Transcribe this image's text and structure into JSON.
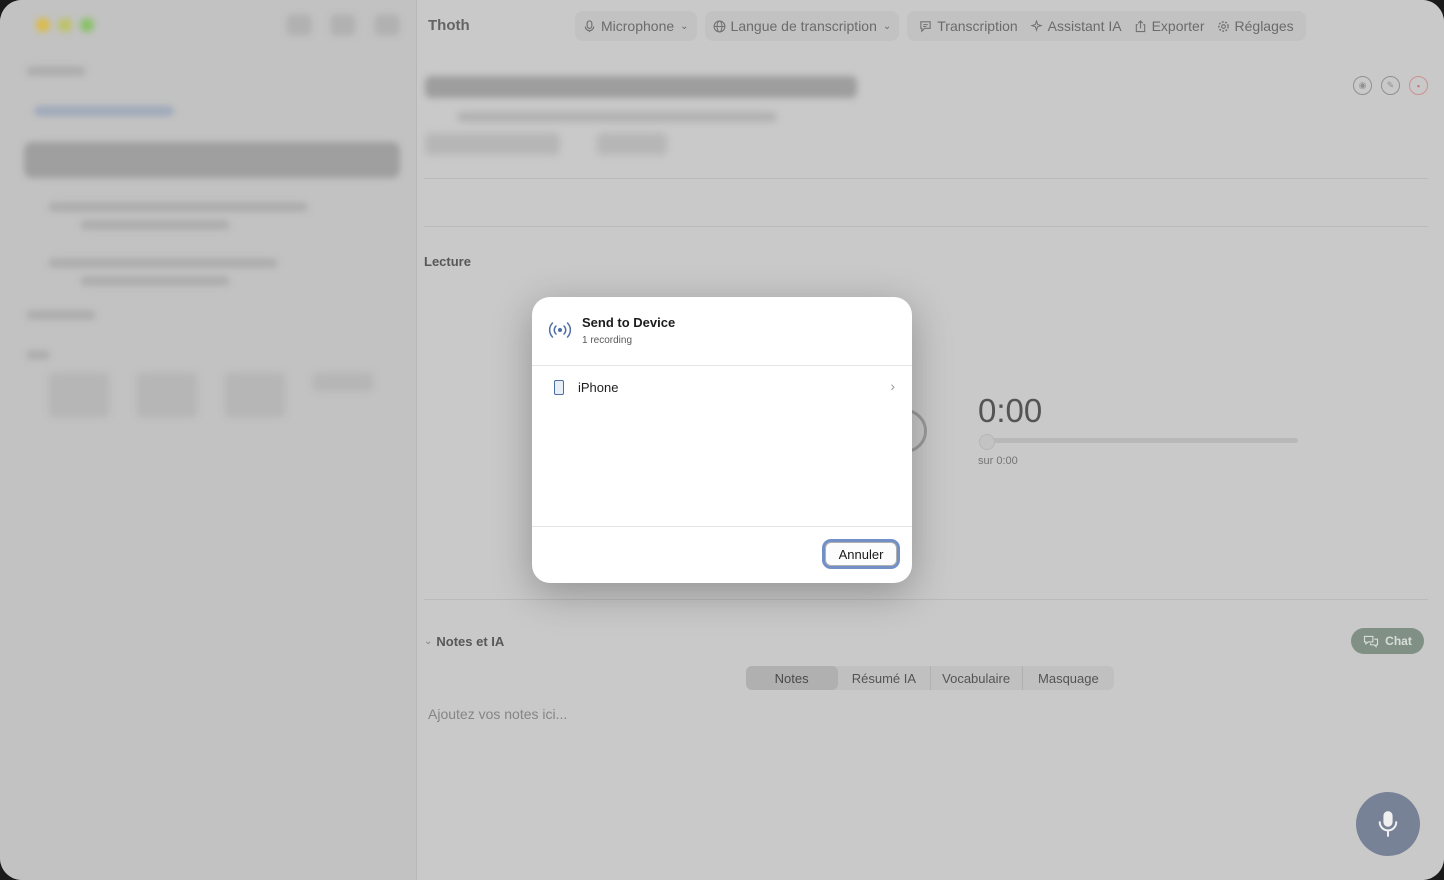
{
  "app": {
    "title": "Thoth"
  },
  "toolbar": {
    "microphone": "Microphone",
    "language": "Langue de transcription",
    "transcription": "Transcription",
    "assistant": "Assistant IA",
    "export": "Exporter",
    "settings": "Réglages"
  },
  "playback": {
    "section_label": "Lecture",
    "time": "0:00",
    "duration_label": "sur 0:00",
    "progress": 0
  },
  "notes": {
    "section_label": "Notes et IA",
    "chat_label": "Chat",
    "tabs": [
      "Notes",
      "Résumé IA",
      "Vocabulaire",
      "Masquage"
    ],
    "active_tab": "Notes",
    "placeholder": "Ajoutez vos notes ici..."
  },
  "dialog": {
    "title": "Send to Device",
    "subtitle": "1 recording",
    "devices": [
      {
        "name": "iPhone"
      }
    ],
    "cancel_label": "Annuler"
  },
  "colors": {
    "accent": "#4b6ea3",
    "focus_ring": "#7390c6",
    "mic_button": "#7f8ba1",
    "chat_button": "#8a9a8e",
    "delete": "#d58080"
  }
}
